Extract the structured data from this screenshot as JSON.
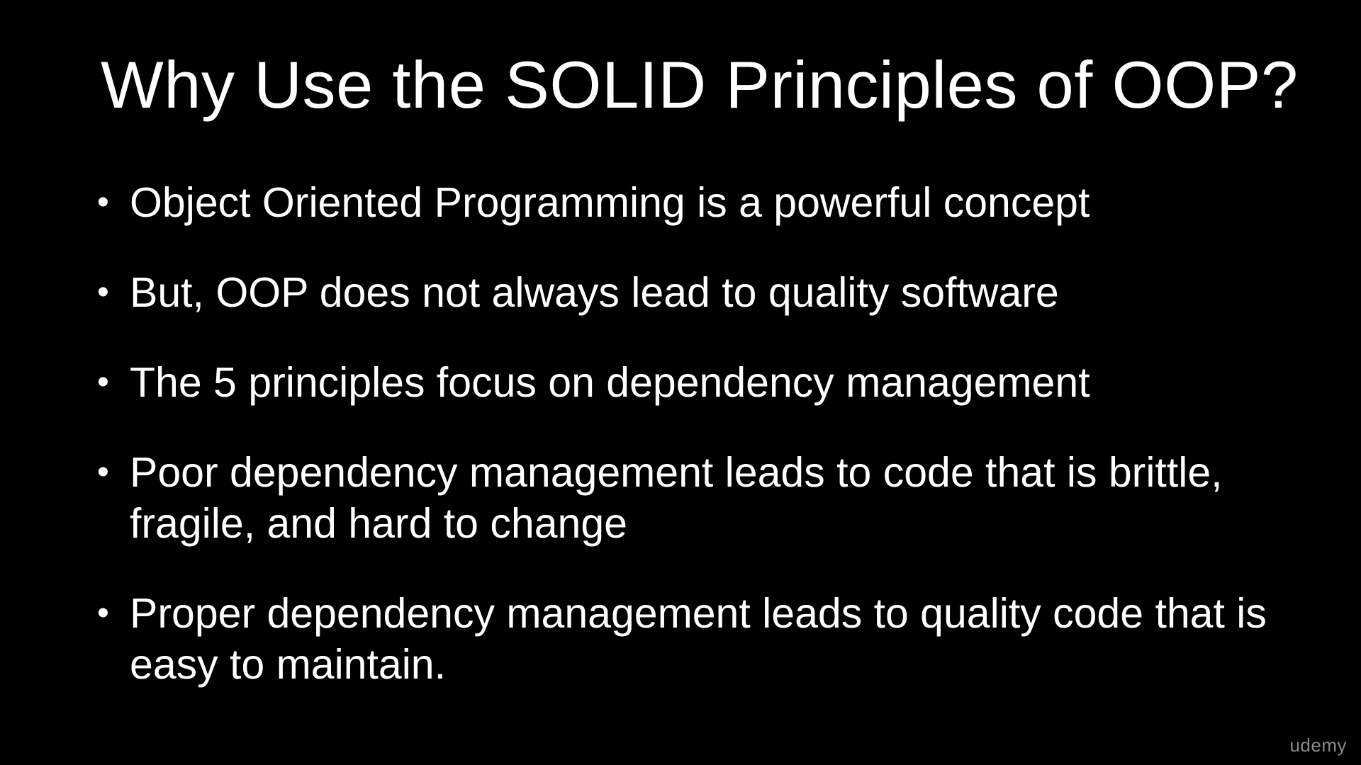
{
  "slide": {
    "title": "Why Use the SOLID Principles of OOP?",
    "bullet_symbol": "•",
    "bullets": [
      "Object Oriented Programming is a powerful concept",
      "But, OOP does not always lead to quality software",
      "The 5 principles focus on dependency management",
      "Poor dependency management leads to code that is brittle, fragile, and hard to change",
      "Proper dependency management leads to quality code that is easy to maintain."
    ]
  },
  "watermark": {
    "text": "udemy"
  },
  "colors": {
    "background": "#000000",
    "text": "#ffffff",
    "watermark": "#8a8a8a"
  }
}
